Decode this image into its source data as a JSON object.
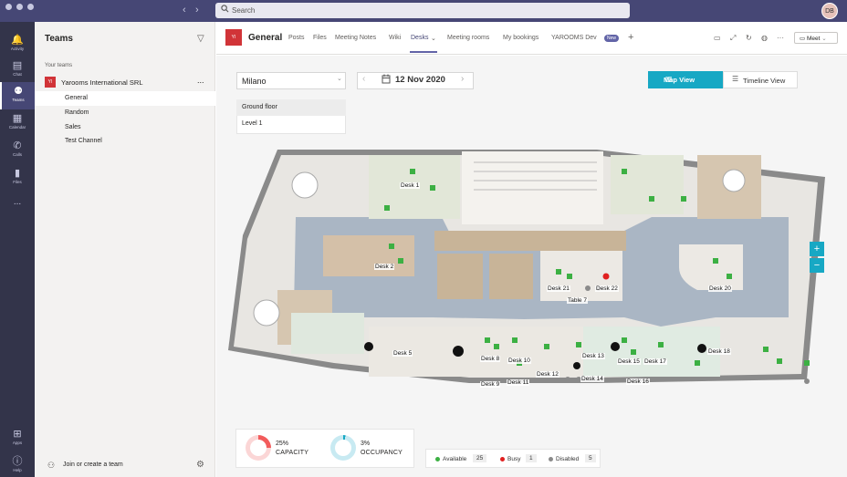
{
  "app": {
    "search_placeholder": "Search",
    "avatar_initials": "DB"
  },
  "rail": {
    "items": [
      {
        "label": "Activity",
        "icon": "bell-icon"
      },
      {
        "label": "Chat",
        "icon": "chat-icon"
      },
      {
        "label": "Teams",
        "icon": "teams-icon"
      },
      {
        "label": "Calendar",
        "icon": "calendar-icon"
      },
      {
        "label": "Calls",
        "icon": "phone-icon"
      },
      {
        "label": "Files",
        "icon": "file-icon"
      },
      {
        "label": "Apps",
        "icon": "apps-icon"
      },
      {
        "label": "Help",
        "icon": "help-icon"
      }
    ],
    "more": "..."
  },
  "teams_panel": {
    "title": "Teams",
    "section": "Your teams",
    "team_logo": "YI",
    "team_name": "Yarooms International SRL",
    "more": "...",
    "channels": [
      "General",
      "Random",
      "Sales",
      "Test Channel"
    ],
    "join": "Join or create a team"
  },
  "header": {
    "logo": "YI",
    "channel": "General",
    "tabs": [
      "Posts",
      "Files",
      "Meeting Notes",
      "Wiki",
      "Desks",
      "Meeting rooms",
      "My bookings",
      "YAROOMS Dev"
    ],
    "new_badge": "New",
    "meet": "Meet"
  },
  "desks": {
    "location": "Milano",
    "date": "12 Nov 2020",
    "floors": [
      "Ground floor",
      "Level 1"
    ],
    "map_view": "Map View",
    "timeline_view": "Timeline View",
    "zoom_in": "+",
    "zoom_out": "−",
    "desk_labels": [
      "Desk 1",
      "Desk 2",
      "Desk 21",
      "Desk 22",
      "Table 7",
      "Desk 20",
      "Desk 5",
      "Desk 8",
      "Desk 10",
      "Desk 12",
      "Desk 9",
      "Desk 11",
      "Desk 13",
      "Desk 14",
      "Desk 15",
      "Desk 17",
      "Desk 16",
      "Desk 18"
    ]
  },
  "stats": {
    "capacity_pct": "25%",
    "capacity_label": "CAPACITY",
    "capacity_value": 0.25,
    "occupancy_pct": "3%",
    "occupancy_label": "OCCUPANCY",
    "occupancy_value": 0.03
  },
  "legend": {
    "available": "Available",
    "available_count": "25",
    "busy": "Busy",
    "busy_count": "1",
    "disabled": "Disabled",
    "disabled_count": "5",
    "available_color": "#3cb043",
    "busy_color": "#e02020",
    "disabled_color": "#8a8a8a"
  }
}
